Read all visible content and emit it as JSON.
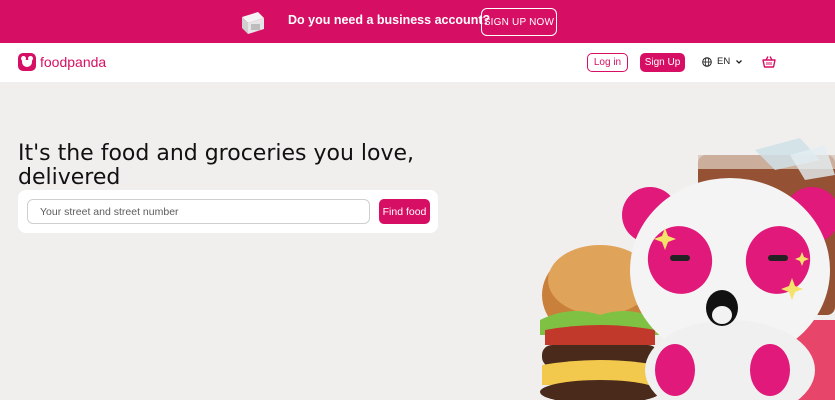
{
  "promo": {
    "icon": "briefcase-icon",
    "text": "Do you need a business account?",
    "button_label": "SIGN UP NOW"
  },
  "header": {
    "brand": "foodpanda",
    "login_label": "Log in",
    "signup_label": "Sign Up",
    "language": "EN",
    "cart_icon": "basket-icon"
  },
  "hero": {
    "title": "It's the food and groceries you love, delivered",
    "search": {
      "placeholder": "Your street and street number",
      "value": ""
    },
    "find_label": "Find food"
  },
  "colors": {
    "brand": "#d70f64",
    "background": "#f1efee"
  }
}
